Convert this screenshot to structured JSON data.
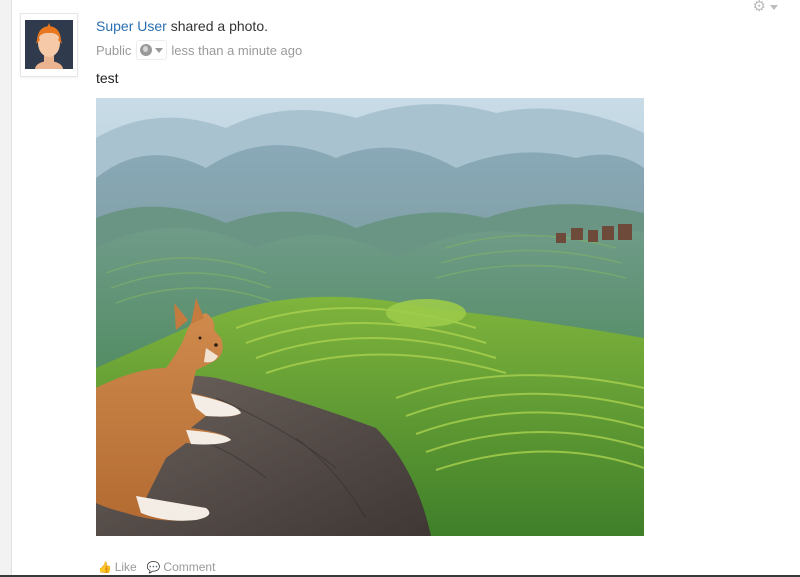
{
  "post": {
    "author": "Super User",
    "action_text": " shared a photo.",
    "visibility": "Public",
    "timestamp": "less than a minute ago",
    "message": "test"
  },
  "actions": {
    "like_label": "Like",
    "comment_label": "Comment"
  },
  "icons": {
    "settings": "gear-icon",
    "visibility": "globe-icon",
    "like": "thumbs-up-icon",
    "comment": "speech-bubble-icon"
  },
  "colors": {
    "link": "#2a6fb1",
    "meta": "#9a9a9a"
  }
}
